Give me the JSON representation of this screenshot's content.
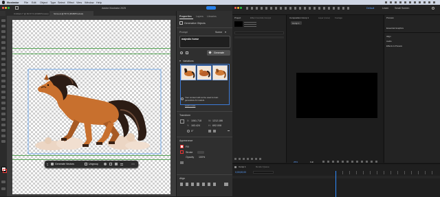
{
  "menu": {
    "app_name": "Illustrator",
    "items": [
      "File",
      "Edit",
      "Object",
      "Type",
      "Select",
      "Effect",
      "View",
      "Window",
      "Help"
    ]
  },
  "illustrator": {
    "window_title": "Adobe Illustrator 2025",
    "doc_tabs": [
      "Untitled-1* @ 66.67 % (RGB/Preview)",
      "horse.ai @ 50 % (RGB/Preview)"
    ],
    "context_bar": {
      "generate": "Generate Vectors",
      "ungroup": "Ungroup"
    },
    "panel": {
      "tabs": [
        "Properties",
        "Layers",
        "Libraries"
      ],
      "section_title": "Generative Objects",
      "prompt_label": "Prompt",
      "prompt_type": "Scene",
      "prompt_value": "majestic horse",
      "generate_button": "Generate",
      "variations_label": "Variations",
      "notice": "Your content will not be used to train generative AI models.",
      "learn_more": "Learn more",
      "transform_label": "Transform",
      "x_label": "X:",
      "x_value": "1061.718",
      "y_label": "Y:",
      "y_value": "163.424",
      "w_label": "W:",
      "w_value": "1212.186",
      "h_label": "H:",
      "h_value": "692.008",
      "angle_value": "0°",
      "appearance_label": "Appearance",
      "fill_label": "Fill",
      "stroke_label": "Stroke",
      "opacity_label": "Opacity",
      "opacity_value": "100%",
      "align_label": "Align"
    }
  },
  "after_effects": {
    "tabs": [
      "Project",
      "Effect Controls Comp1"
    ],
    "comp_tab": "Composition Comp 1",
    "layer_tab": "Layer (none)",
    "footage_tab": "Footage",
    "comp_button": "Comp 1",
    "timeline_tab": "Comp 1",
    "render_tab": "Render Queue",
    "timecode": "0;00;00;00",
    "right_panels": [
      "Preview",
      "Essential Graphics"
    ],
    "right_items": [
      "Align",
      "Audio",
      "Effects & Presets"
    ],
    "zoom": "25%",
    "quality": "Full",
    "workspace": "Default",
    "workspace_alt": "Learn",
    "workspace_alt2": "Small Screen"
  },
  "colors": {
    "guide": "#3c9a3c",
    "accent": "#2680eb",
    "horse_main": "#c8702e",
    "horse_dark": "#8a4a1c",
    "mane": "#2c1c14",
    "cloud": "#ecd6c4"
  }
}
